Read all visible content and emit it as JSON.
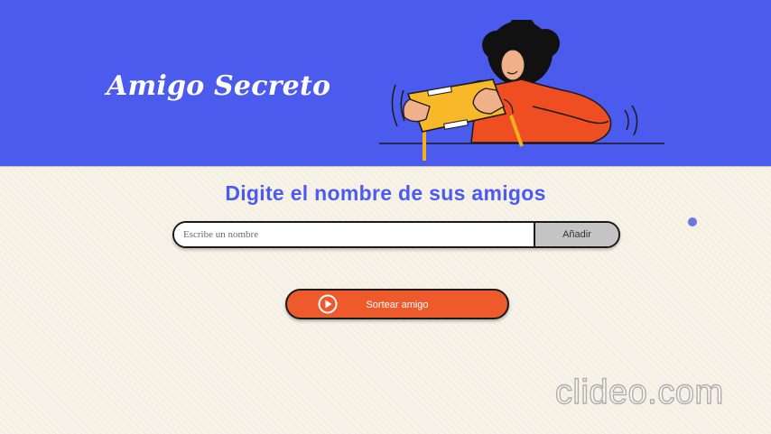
{
  "header": {
    "title": "Amigo Secreto",
    "illustration": "person-holding-gift-icon",
    "background_color": "#4b5bee"
  },
  "main": {
    "heading": "Digite el nombre de sus amigos",
    "input": {
      "placeholder": "Escribe un nombre",
      "value": ""
    },
    "add_button": "Añadir",
    "draw_button": {
      "label": "Sortear amigo",
      "icon": "play-icon",
      "color": "#ef5a2c"
    }
  },
  "watermark": "clideo.com",
  "colors": {
    "accent": "#4b5bee",
    "background": "#f7f2e8",
    "button_orange": "#ef5a2c",
    "button_gray": "#c4c4c4"
  }
}
